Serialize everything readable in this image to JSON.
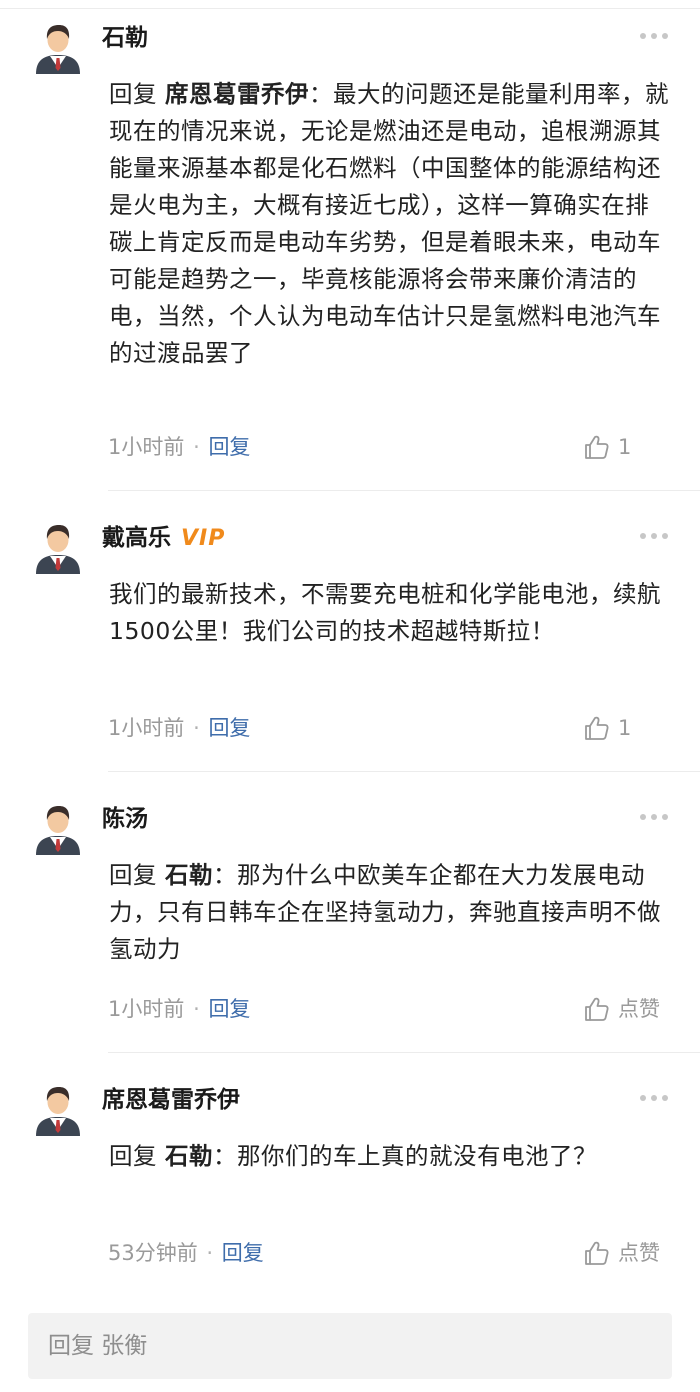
{
  "comments": [
    {
      "username": "石勒",
      "vip": "",
      "reply_prefix": "回复 ",
      "reply_target": "席恩葛雷乔伊",
      "reply_colon": "：",
      "text": "最大的问题还是能量利用率，就现在的情况来说，无论是燃油还是电动，追根溯源其能量来源基本都是化石燃料（中国整体的能源结构还是火电为主，大概有接近七成），这样一算确实在排碳上肯定反而是电动车劣势，但是着眼未来，电动车可能是趋势之一，毕竟核能源将会带来廉价清洁的电，当然，个人认为电动车估计只是氢燃料电池汽车的过渡品罢了",
      "time": "1小时前",
      "dot": "·",
      "reply_label": "回复",
      "likes": "1"
    },
    {
      "username": "戴高乐",
      "vip": "VIP",
      "reply_prefix": "",
      "reply_target": "",
      "reply_colon": "",
      "text": "我们的最新技术，不需要充电桩和化学能电池，续航1500公里！我们公司的技术超越特斯拉！",
      "time": "1小时前",
      "dot": "·",
      "reply_label": "回复",
      "likes": "1"
    },
    {
      "username": "陈汤",
      "vip": "",
      "reply_prefix": "回复 ",
      "reply_target": "石勒",
      "reply_colon": "：",
      "text": "那为什么中欧美车企都在大力发展电动力，只有日韩车企在坚持氢动力，奔驰直接声明不做氢动力",
      "time": "1小时前",
      "dot": "·",
      "reply_label": "回复",
      "likes": "点赞"
    },
    {
      "username": "席恩葛雷乔伊",
      "vip": "",
      "reply_prefix": "回复 ",
      "reply_target": "石勒",
      "reply_colon": "：",
      "text": "那你们的车上真的就没有电池了？",
      "time": "53分钟前",
      "dot": "·",
      "reply_label": "回复",
      "likes": "点赞"
    }
  ],
  "reply_bar": {
    "placeholder": "回复 张衡"
  },
  "icons": {
    "avatar": "user-avatar-icon",
    "more": "more-dots-icon",
    "like": "thumbs-up-icon"
  },
  "colors": {
    "link": "#3f6dab",
    "vip": "#f08a1c",
    "muted": "#9a9a9a"
  }
}
